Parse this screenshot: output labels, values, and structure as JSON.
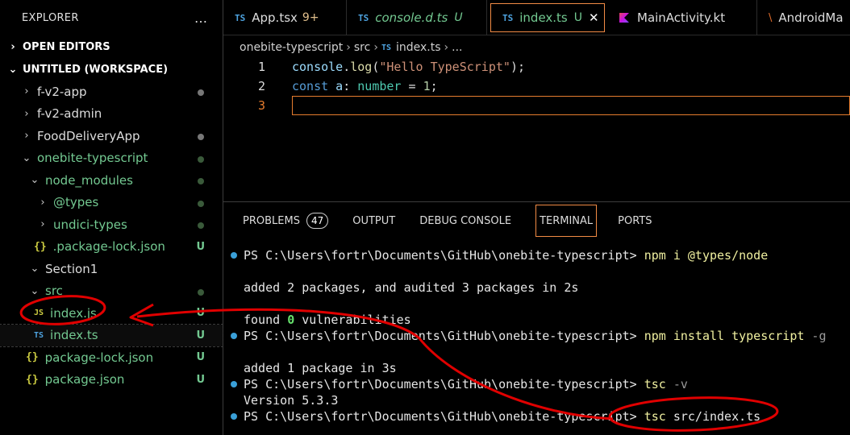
{
  "explorer": {
    "title": "EXPLORER",
    "more": "…",
    "open_editors": "OPEN EDITORS",
    "workspace": "UNTITLED (WORKSPACE)",
    "items": [
      {
        "label": "f-v2-app"
      },
      {
        "label": "f-v2-admin"
      },
      {
        "label": "FoodDeliveryApp"
      },
      {
        "label": "onebite-typescript"
      },
      {
        "label": "node_modules"
      },
      {
        "label": "@types"
      },
      {
        "label": "undici-types"
      },
      {
        "label": ".package-lock.json",
        "badge": "U"
      },
      {
        "label": "Section1"
      },
      {
        "label": "src"
      },
      {
        "label": "index.js",
        "badge": "U"
      },
      {
        "label": "index.ts",
        "badge": "U"
      },
      {
        "label": "package-lock.json",
        "badge": "U"
      },
      {
        "label": "package.json",
        "badge": "U"
      }
    ]
  },
  "tabs": [
    {
      "icon": "TS",
      "label": "App.tsx",
      "status": "9+"
    },
    {
      "icon": "TS",
      "label": "console.d.ts",
      "status": "U"
    },
    {
      "icon": "TS",
      "label": "index.ts",
      "status": "U",
      "close": "✕"
    },
    {
      "label": "MainActivity.kt"
    },
    {
      "label": "AndroidMa"
    }
  ],
  "breadcrumb": {
    "part1": "onebite-typescript",
    "part2": "src",
    "icon": "TS",
    "part3": "index.ts",
    "part4": "..."
  },
  "editor": {
    "lines": [
      {
        "num": "1",
        "tokens": [
          "console",
          ".",
          "log",
          "(",
          "\"Hello TypeScript\"",
          ");"
        ]
      },
      {
        "num": "2",
        "tokens": [
          "const",
          " a",
          ": ",
          "number",
          " = ",
          "1",
          ";"
        ]
      },
      {
        "num": "3"
      }
    ]
  },
  "panel": {
    "tabs": [
      "PROBLEMS",
      "OUTPUT",
      "DEBUG CONSOLE",
      "TERMINAL",
      "PORTS"
    ],
    "problems_count": "47"
  },
  "terminal": {
    "prompt": "PS C:\\Users\\fortr\\Documents\\GitHub\\onebite-typescript> ",
    "cmd1": "npm i @types/node",
    "out1": "added 2 packages, and audited 3 packages in 2s",
    "out2a": "found ",
    "out2b": "0",
    "out2c": " vulnerabilities",
    "cmd2": "npm install typescript",
    "cmd2flag": " -g",
    "out3": "added 1 package in 3s",
    "cmd3": "tsc",
    "cmd3flag": " -v",
    "out4": "Version 5.3.3",
    "cmd4a": "tsc",
    "cmd4b": " src/index.ts"
  },
  "colors": {
    "accent": "#f28b45",
    "annotation": "#e00000",
    "untracked": "#73c991"
  }
}
